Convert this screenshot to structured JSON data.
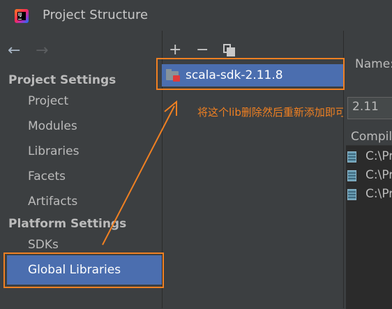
{
  "window": {
    "title": "Project Structure"
  },
  "nav": {
    "back_symbol": "←",
    "forward_symbol": "→"
  },
  "sidebar": {
    "project_settings_title": "Project Settings",
    "project_items": [
      "Project",
      "Modules",
      "Libraries",
      "Facets",
      "Artifacts"
    ],
    "platform_settings_title": "Platform Settings",
    "platform_items": [
      "SDKs",
      "Global Libraries"
    ],
    "selected_item": "Global Libraries"
  },
  "toolbar": {
    "add_symbol": "+",
    "remove_symbol": "−"
  },
  "libraries": [
    {
      "name": "scala-sdk-2.11.8",
      "selected": true
    }
  ],
  "annotation": {
    "text": "将这个lib删除然后重新添加即可",
    "color": "#f08022"
  },
  "details": {
    "name_label": "Name:",
    "version_value": "2.11",
    "compiler_label": "Compiler classpath:",
    "classpath_items": [
      "C:\\Pr",
      "C:\\Pr",
      "C:\\Pr"
    ]
  },
  "colors": {
    "accent_selection": "#4b6eaf",
    "highlight_box": "#f08022",
    "background": "#3c3f41"
  },
  "icons": [
    "intellij-app-icon",
    "back-arrow-icon",
    "forward-arrow-icon",
    "add-icon",
    "remove-icon",
    "copy-icon",
    "scala-library-icon",
    "jar-icon"
  ]
}
